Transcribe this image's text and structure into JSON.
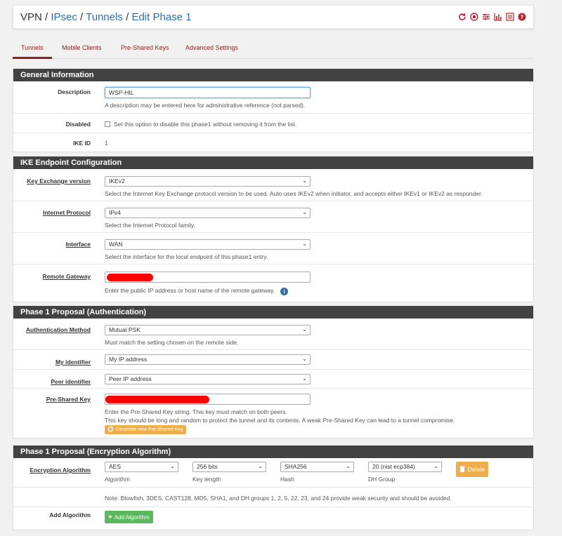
{
  "breadcrumb": {
    "root": "VPN",
    "items": [
      "IPsec",
      "Tunnels",
      "Edit Phase 1"
    ],
    "sep": "/"
  },
  "toolbar_icons": [
    "reload-icon",
    "stop-icon",
    "settings-icon",
    "chart-icon",
    "list-icon",
    "help-icon"
  ],
  "tabs": [
    {
      "label": "Tunnels",
      "active": true
    },
    {
      "label": "Mobile Clients"
    },
    {
      "label": "Pre-Shared Keys"
    },
    {
      "label": "Advanced Settings"
    }
  ],
  "general": {
    "title": "General Information",
    "description_label": "Description",
    "description_value": "WSP-HIL",
    "description_help": "A description may be entered here for administrative reference (not parsed).",
    "disabled_label": "Disabled",
    "disabled_help": "Set this option to disable this phase1 without removing it from the list.",
    "ikeid_label": "IKE ID",
    "ikeid_value": "1"
  },
  "ike": {
    "title": "IKE Endpoint Configuration",
    "kex_label": "Key Exchange version",
    "kex_value": "IKEv2",
    "kex_help": "Select the Internet Key Exchange protocol version to be used. Auto uses IKEv2 when initiator, and accepts either IKEv1 or IKEv2 as responder.",
    "proto_label": "Internet Protocol",
    "proto_value": "IPv4",
    "proto_help": "Select the Internet Protocol family.",
    "iface_label": "Interface",
    "iface_value": "WAN",
    "iface_help": "Select the interface for the local endpoint of this phase1 entry.",
    "gw_label": "Remote Gateway",
    "gw_help": "Enter the public IP address or host name of the remote gateway."
  },
  "auth": {
    "title": "Phase 1 Proposal (Authentication)",
    "method_label": "Authentication Method",
    "method_value": "Mutual PSK",
    "method_help": "Must match the setting chosen on the remote side.",
    "myid_label": "My identifier",
    "myid_value": "My IP address",
    "peerid_label": "Peer identifier",
    "peerid_value": "Peer IP address",
    "psk_label": "Pre-Shared Key",
    "psk_help1": "Enter the Pre-Shared Key string. This key must match on both peers.",
    "psk_help2": "This key should be long and random to protect the tunnel and its contents. A weak Pre-Shared Key can lead to a tunnel compromise.",
    "gen_button": "Generate new Pre-Shared Key"
  },
  "enc": {
    "title": "Phase 1 Proposal (Encryption Algorithm)",
    "alg_label": "Encryption Algorithm",
    "alg_value": "AES",
    "alg_caption": "Algorithm",
    "keylen_value": "256 bits",
    "keylen_caption": "Key length",
    "hash_value": "SHA256",
    "hash_caption": "Hash",
    "dh_value": "20 (nist ecp384)",
    "dh_caption": "DH Group",
    "delete_button": "Delete",
    "note": "Note: Blowfish, 3DES, CAST128, MD5, SHA1, and DH groups 1, 2, 5, 22, 23, and 24 provide weak security and should be avoided.",
    "add_label": "Add Algorithm",
    "add_button": "Add Algorithm"
  },
  "colors": {
    "header": "#424242",
    "link": "#2d6ea8",
    "tab": "#8b2222",
    "warning": "#f0ad4e",
    "success": "#5cb85c",
    "redaction": "#ff0000"
  }
}
